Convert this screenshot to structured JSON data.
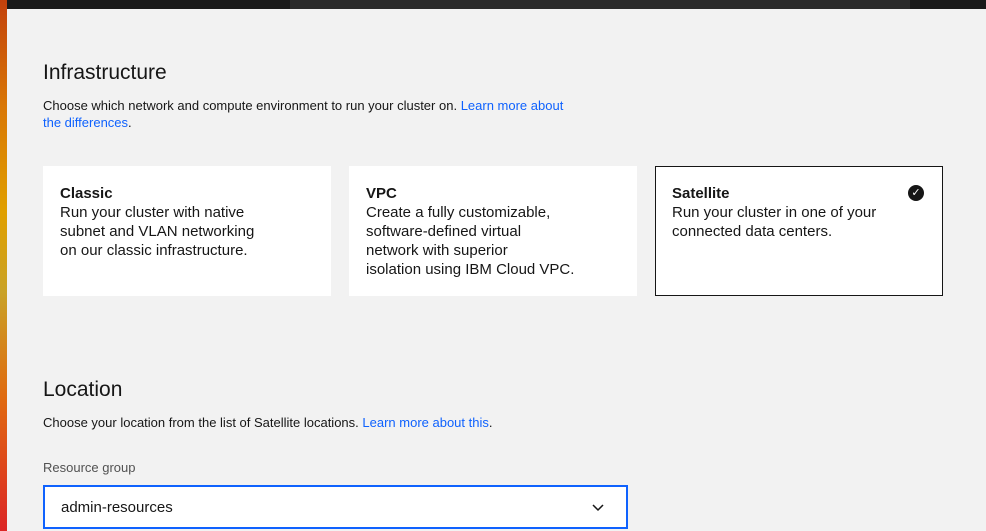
{
  "infrastructure": {
    "heading": "Infrastructure",
    "description": "Choose which network and compute environment to run your cluster on.",
    "link_line1": "Learn more about",
    "link_line2": "the differences",
    "link_suffix": ".",
    "options": [
      {
        "title": "Classic",
        "lines": [
          "Run your cluster with native",
          "subnet and VLAN networking",
          "on our classic infrastructure."
        ],
        "selected": false
      },
      {
        "title": "VPC",
        "lines": [
          "Create a fully customizable,",
          "software-defined virtual",
          "network with superior",
          "isolation using IBM Cloud VPC."
        ],
        "selected": false
      },
      {
        "title": "Satellite",
        "lines": [
          "Run your cluster in one of your",
          "connected data centers."
        ],
        "selected": true
      }
    ],
    "check_icon": "checkmark-filled-icon"
  },
  "location": {
    "heading": "Location",
    "description": "Choose your location from the list of Satellite locations.",
    "link": "Learn more about this",
    "link_suffix": "."
  },
  "resource_group": {
    "label": "Resource group",
    "value": "admin-resources",
    "icon": "chevron-down-icon"
  },
  "colors": {
    "accent": "#0f62fe",
    "background": "#f2f2f2",
    "tile": "#ffffff",
    "text": "#161616"
  }
}
